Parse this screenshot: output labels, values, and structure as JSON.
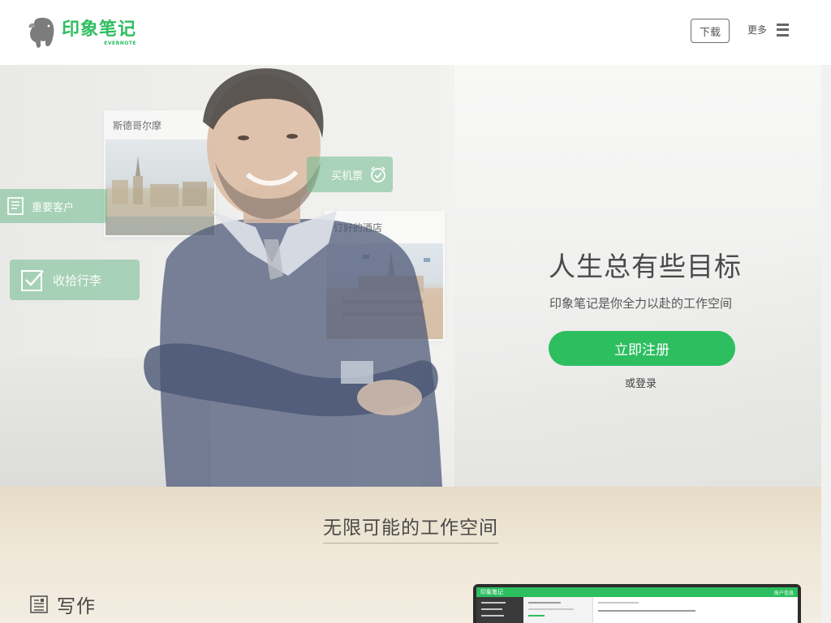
{
  "header": {
    "logo_cn": "印象笔记",
    "logo_en": "EVERNOTE",
    "download_label": "下载",
    "more_label": "更多"
  },
  "hero": {
    "cards": {
      "stockholm": "斯德哥尔摩",
      "buy_ticket": "买机票",
      "key_clients": "重要客户",
      "hotel": "订好的酒店",
      "pack": "收拾行李"
    },
    "title": "人生总有些目标",
    "subtitle": "印象笔记是你全力以赴的工作空间",
    "signup_label": "立即注册",
    "login_label": "或登录"
  },
  "section": {
    "title": "无限可能的工作空间",
    "write_label": "写作"
  },
  "app_preview": {
    "title": "印象笔记",
    "account": "账户信息"
  },
  "colors": {
    "brand_green": "#2dbe60",
    "pill_green": "#6fbc8e",
    "text_dark": "#4a4a4a"
  }
}
